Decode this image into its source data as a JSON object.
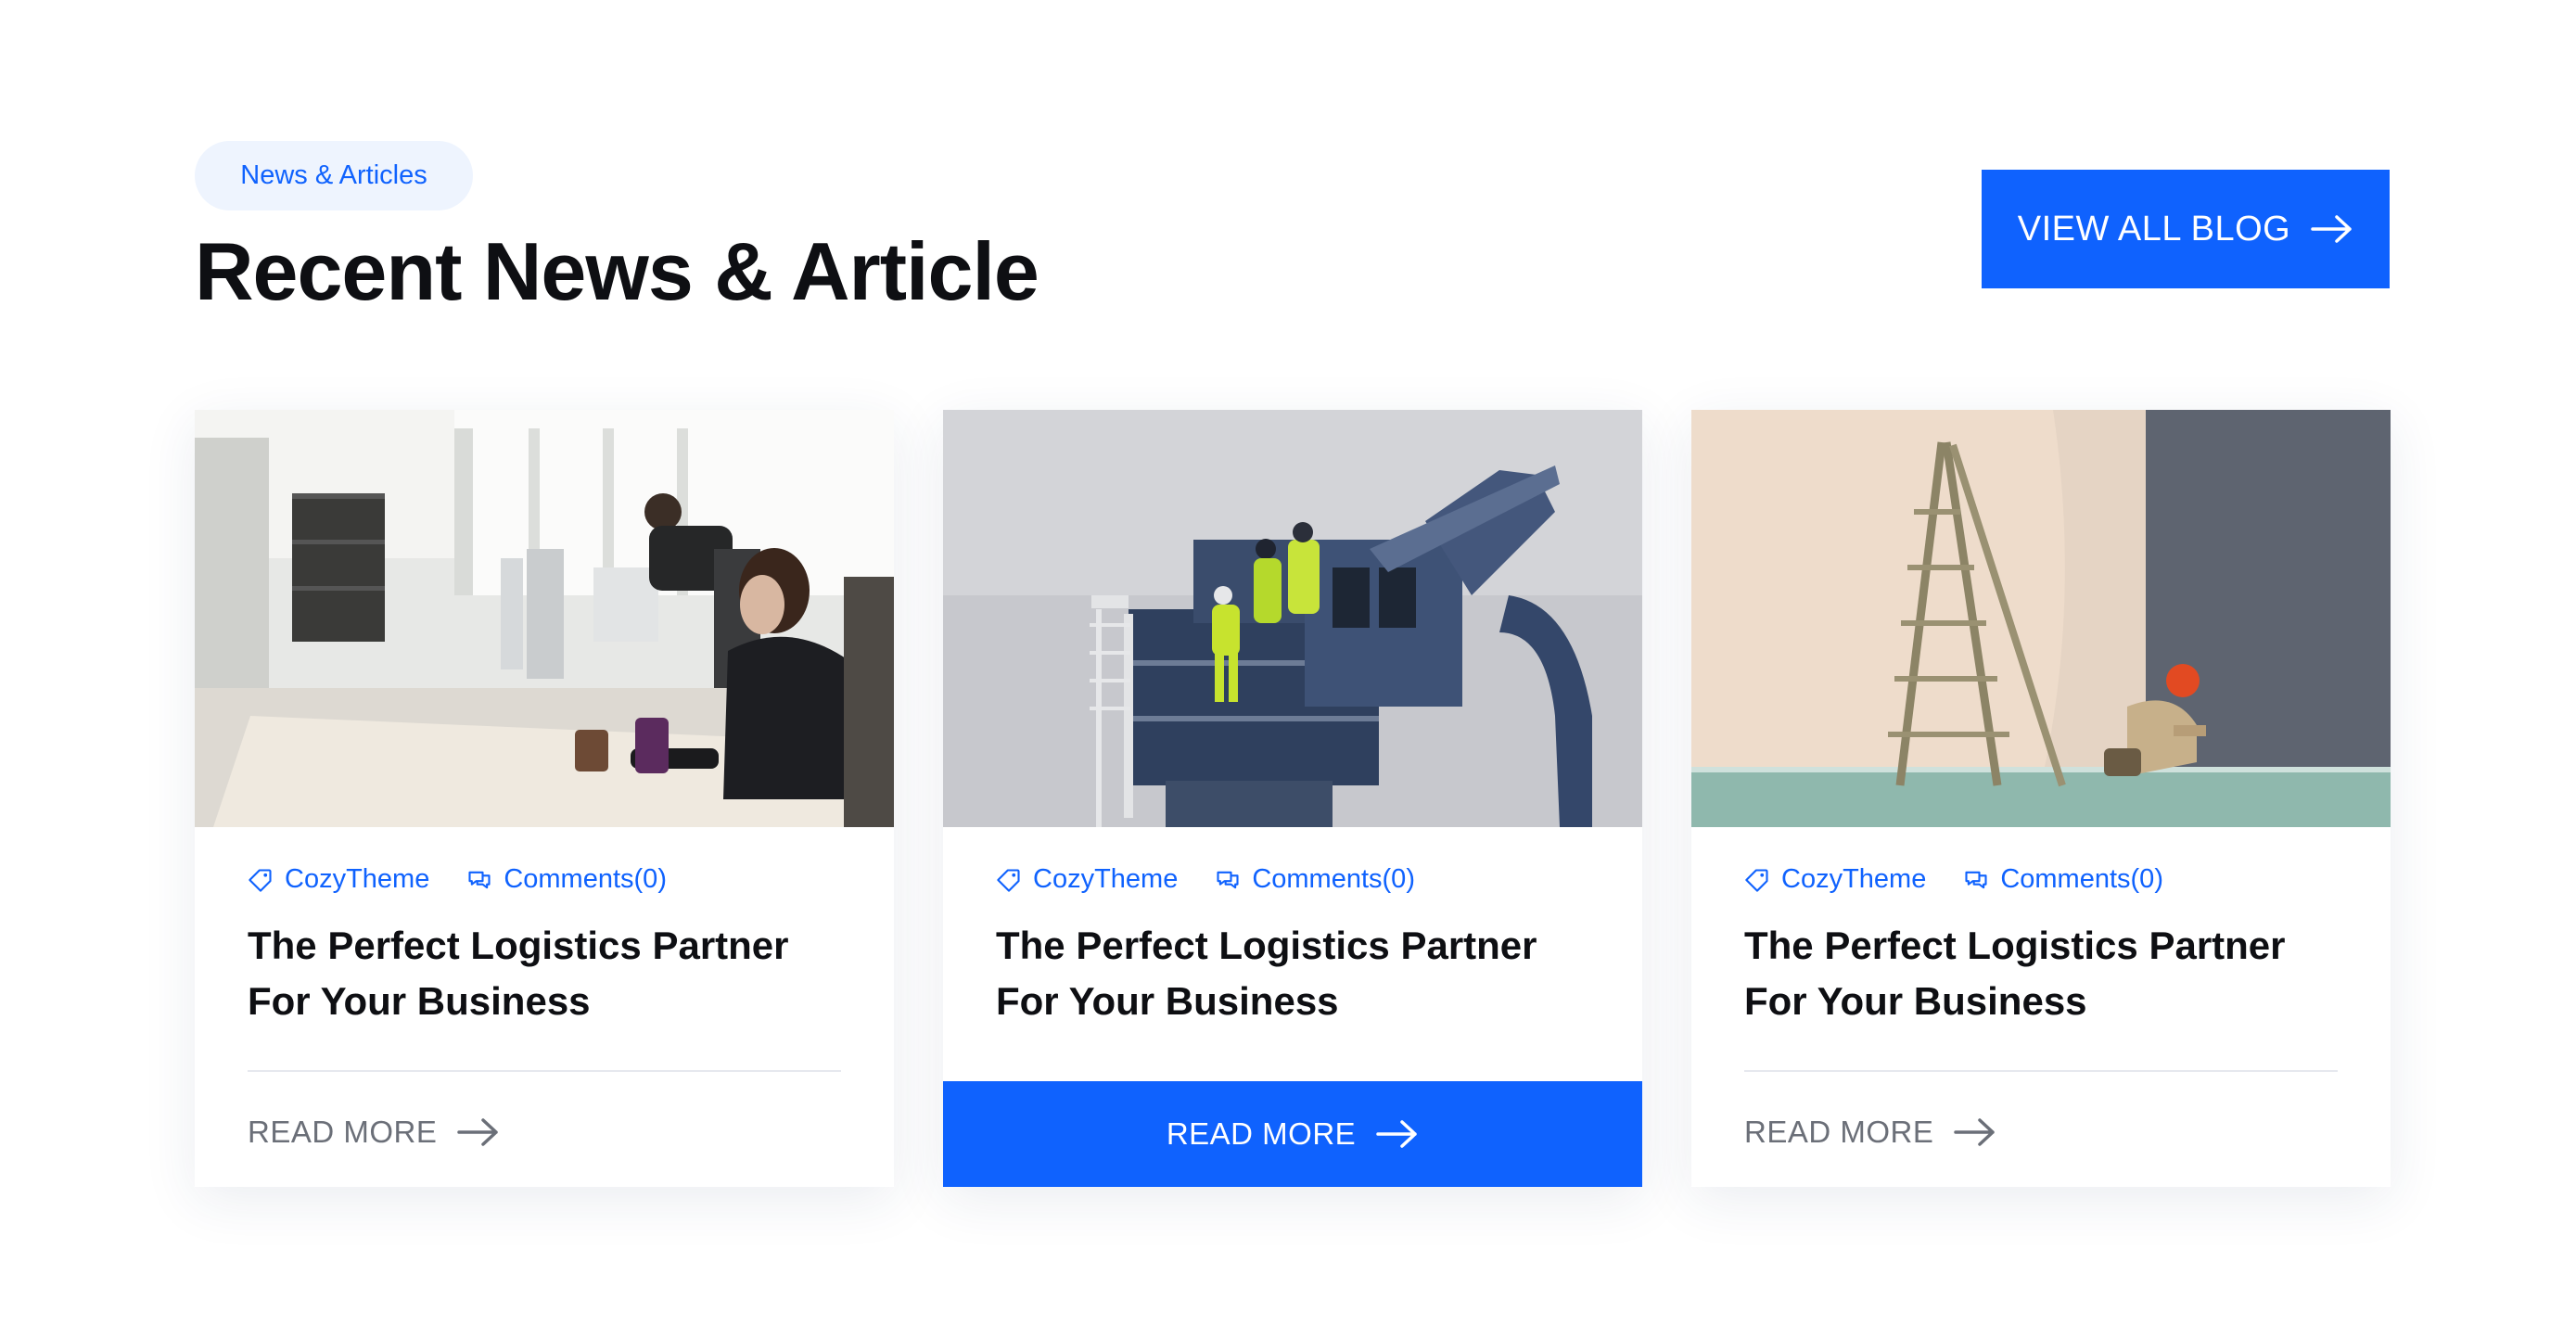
{
  "header": {
    "eyebrow": "News & Articles",
    "title": "Recent News & Article",
    "view_all_label": "VIEW ALL BLOG"
  },
  "colors": {
    "accent": "#0f62fe",
    "eyebrow_bg": "#eef4fe",
    "title": "#0e0f13",
    "muted": "#6b6f78"
  },
  "cards": [
    {
      "image_alt": "office-workers-photo",
      "author": "CozyTheme",
      "comments": "Comments(0)",
      "title": "The Perfect Logistics Partner For Your Business",
      "cta": "READ MORE",
      "cta_active": false
    },
    {
      "image_alt": "crane-workers-photo",
      "author": "CozyTheme",
      "comments": "Comments(0)",
      "title": "The Perfect Logistics Partner For Your Business",
      "cta": "READ MORE",
      "cta_active": true
    },
    {
      "image_alt": "floor-worker-ladder-photo",
      "author": "CozyTheme",
      "comments": "Comments(0)",
      "title": "The Perfect Logistics Partner For Your Business",
      "cta": "READ MORE",
      "cta_active": false
    }
  ],
  "icons": {
    "tag": "tag-icon",
    "comments": "comments-icon",
    "arrow": "arrow-right-icon"
  }
}
